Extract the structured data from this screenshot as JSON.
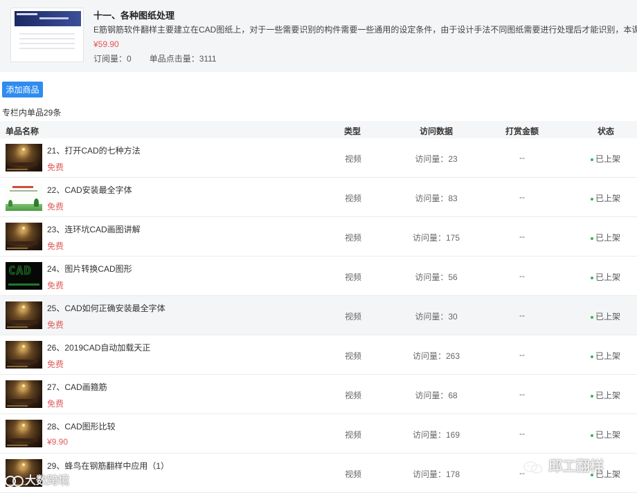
{
  "column": {
    "title": "十一、各种图纸处理",
    "description": "E筋钢筋软件翻样主要建立在CAD图纸上，对于一些需要识别的构件需要一些通用的设定条件，由于设计手法不同图纸需要进行处理后才能识别，本课",
    "price": "¥59.90",
    "subscriptions": "订阅量：0",
    "clicks": "单品点击量：3111"
  },
  "toolbar": {
    "add_label": "添加商品"
  },
  "summary": "专栏内单品29条",
  "table": {
    "headers": {
      "name": "单品名称",
      "type": "类型",
      "visits": "访问数据",
      "reward": "打赏金额",
      "status": "状态"
    },
    "rows": [
      {
        "title": "21、打开CAD的七种方法",
        "price": "免费",
        "type": "视频",
        "visits": "访问量：23",
        "reward": "--",
        "status": "已上架",
        "thumb": "dark"
      },
      {
        "title": "22、CAD安装最全字体",
        "price": "免费",
        "type": "视频",
        "visits": "访问量：83",
        "reward": "--",
        "status": "已上架",
        "thumb": "green"
      },
      {
        "title": "23、连环坑CAD画图讲解",
        "price": "免费",
        "type": "视频",
        "visits": "访问量：175",
        "reward": "--",
        "status": "已上架",
        "thumb": "dark"
      },
      {
        "title": "24、图片转换CAD图形",
        "price": "免费",
        "type": "视频",
        "visits": "访问量：56",
        "reward": "--",
        "status": "已上架",
        "thumb": "black"
      },
      {
        "title": "25、CAD如何正确安装最全字体",
        "price": "免费",
        "type": "视频",
        "visits": "访问量：30",
        "reward": "--",
        "status": "已上架",
        "thumb": "dark"
      },
      {
        "title": "26、2019CAD自动加载天正",
        "price": "免费",
        "type": "视频",
        "visits": "访问量：263",
        "reward": "--",
        "status": "已上架",
        "thumb": "dark"
      },
      {
        "title": "27、CAD画箍筋",
        "price": "免费",
        "type": "视频",
        "visits": "访问量：68",
        "reward": "--",
        "status": "已上架",
        "thumb": "dark"
      },
      {
        "title": "28、CAD图形比较",
        "price": "¥9.90",
        "type": "视频",
        "visits": "访问量：169",
        "reward": "--",
        "status": "已上架",
        "thumb": "dark"
      },
      {
        "title": "29、蜂鸟在钢筋翻样中应用（1）",
        "price": "",
        "type": "视频",
        "visits": "访问量：178",
        "reward": "--",
        "status": "已上架",
        "thumb": "dark"
      }
    ]
  },
  "watermarks": {
    "right": "邱工翻样",
    "left": "大数跨境"
  },
  "colors": {
    "accent": "#2f8cf0",
    "price": "#e05a5a",
    "status_dot": "#2db84d"
  }
}
